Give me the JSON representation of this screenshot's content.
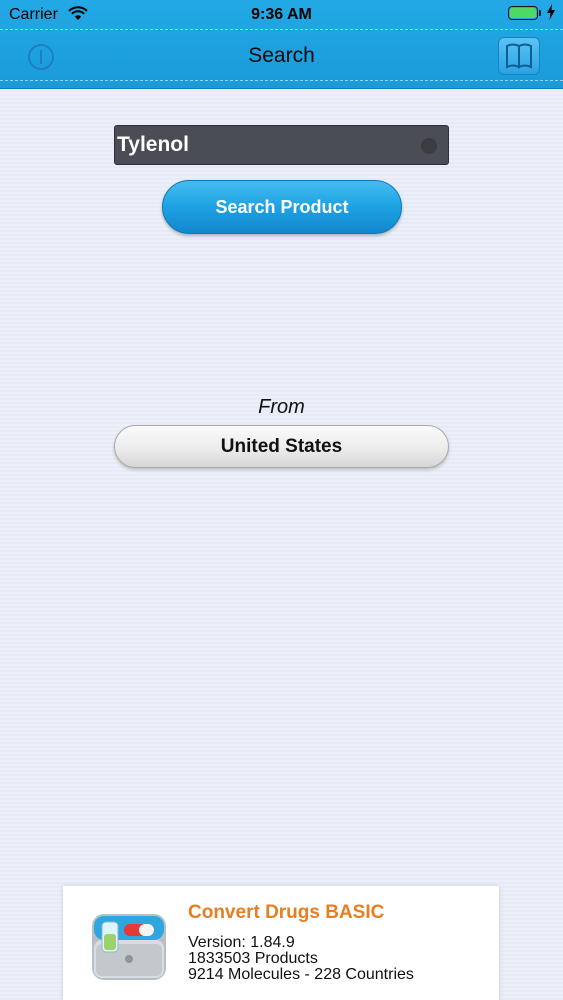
{
  "status_bar": {
    "carrier": "Carrier",
    "time": "9:36 AM",
    "battery_percent": 100
  },
  "nav": {
    "title": "Search",
    "left_icon": "info-icon",
    "right_icon": "book-icon"
  },
  "search": {
    "value": "Tylenol",
    "button_label": "Search Product"
  },
  "origin": {
    "label": "From",
    "country": "United States"
  },
  "footer": {
    "app_name": "Convert Drugs BASIC",
    "version": "Version: 1.84.9",
    "products": "1833503 Products",
    "stats": "9214 Molecules - 228 Countries",
    "icon": "app-medicine-box-icon"
  },
  "colors": {
    "nav_bar": "#1a9ad9",
    "primary_button": "#1ea2e3",
    "app_name": "#e67e22"
  }
}
